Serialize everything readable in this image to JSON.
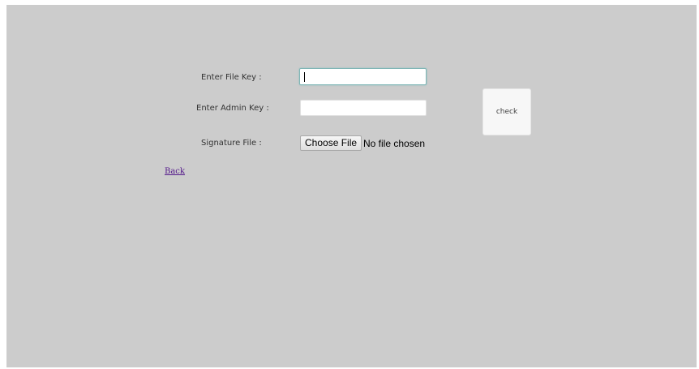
{
  "form": {
    "file_key_label": "Enter File Key :",
    "file_key_value": "",
    "admin_key_label": "Enter Admin Key :",
    "admin_key_value": "",
    "signature_label": "Signature File :",
    "choose_file_label": "Choose File",
    "file_status": "No file chosen",
    "check_label": "check"
  },
  "nav": {
    "back_label": "Back"
  },
  "colors": {
    "panel_background": "#cccccc",
    "link_visited": "#551a8b",
    "focus_ring": "#7fb5b5"
  }
}
